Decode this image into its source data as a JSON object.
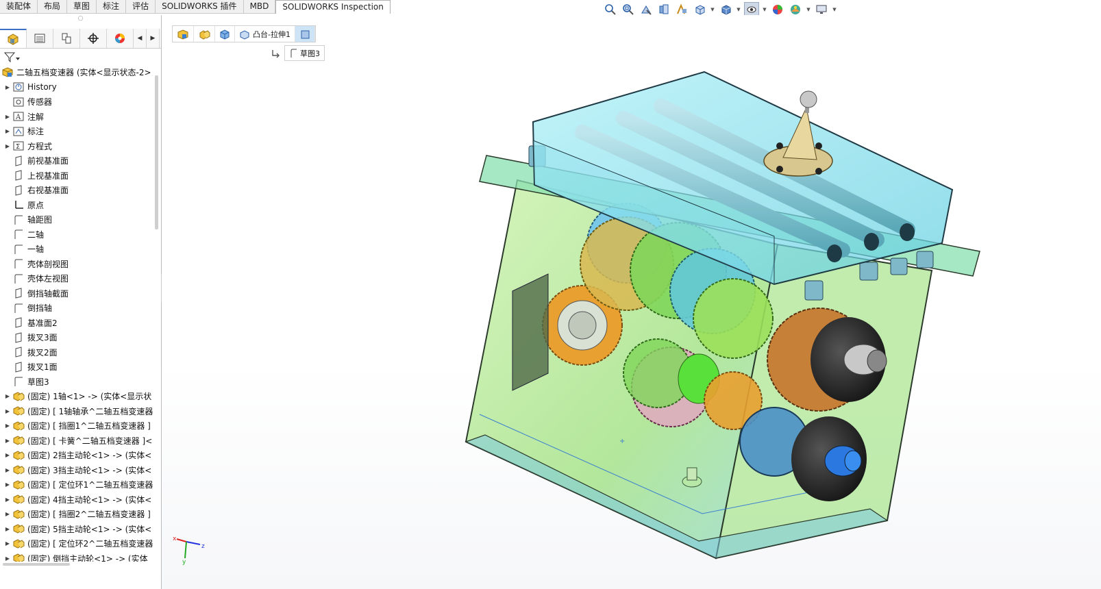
{
  "command_tabs": [
    "装配体",
    "布局",
    "草图",
    "标注",
    "评估",
    "SOLIDWORKS 插件",
    "MBD",
    "SOLIDWORKS Inspection"
  ],
  "active_tab_index": 7,
  "heads_up_toolbar": [
    {
      "icon": "zoom-to-fit-icon"
    },
    {
      "icon": "zoom-area-icon"
    },
    {
      "icon": "previous-view-icon"
    },
    {
      "icon": "section-view-icon"
    },
    {
      "icon": "dynamic-annotation-icon"
    },
    {
      "icon": "view-orientation-icon",
      "dropdown": true
    },
    {
      "icon": "display-style-icon",
      "dropdown": true
    },
    {
      "icon": "hide-show-items-icon",
      "dropdown": true,
      "active": true
    },
    {
      "icon": "edit-appearance-icon"
    },
    {
      "icon": "apply-scene-icon",
      "dropdown": true
    },
    {
      "icon": "view-settings-icon",
      "dropdown": true
    }
  ],
  "panel_tabs": [
    {
      "icon": "featuremanager-tree-icon",
      "active": true
    },
    {
      "icon": "propertymanager-icon"
    },
    {
      "icon": "configurationmanager-icon"
    },
    {
      "icon": "dimxpert-icon"
    },
    {
      "icon": "display-manager-icon"
    }
  ],
  "tree": {
    "root": "二轴五档变速器 (实体<显示状态-2>",
    "items": [
      {
        "label": "History",
        "icon": "history-icon",
        "expand": true
      },
      {
        "label": "传感器",
        "icon": "sensor-icon",
        "expand": false
      },
      {
        "label": "注解",
        "icon": "annotation-icon",
        "expand": true
      },
      {
        "label": "标注",
        "icon": "markup-icon",
        "expand": true
      },
      {
        "label": "方程式",
        "icon": "equation-icon",
        "expand": true
      },
      {
        "label": "前视基准面",
        "icon": "plane-icon",
        "expand": false
      },
      {
        "label": "上视基准面",
        "icon": "plane-icon",
        "expand": false
      },
      {
        "label": "右视基准面",
        "icon": "plane-icon",
        "expand": false
      },
      {
        "label": "原点",
        "icon": "origin-icon",
        "expand": false
      },
      {
        "label": "轴距图",
        "icon": "sketch-icon",
        "expand": false
      },
      {
        "label": "二轴",
        "icon": "sketch-icon",
        "expand": false
      },
      {
        "label": "一轴",
        "icon": "sketch-icon",
        "expand": false
      },
      {
        "label": "壳体剖视图",
        "icon": "sketch-icon",
        "expand": false
      },
      {
        "label": "壳体左视图",
        "icon": "sketch-icon",
        "expand": false
      },
      {
        "label": "倒挡轴截面",
        "icon": "plane-icon",
        "expand": false
      },
      {
        "label": "倒挡轴",
        "icon": "sketch-icon",
        "expand": false
      },
      {
        "label": "基准面2",
        "icon": "plane-icon",
        "expand": false
      },
      {
        "label": "拨叉3面",
        "icon": "plane-icon",
        "expand": false
      },
      {
        "label": "拨叉2面",
        "icon": "plane-icon",
        "expand": false
      },
      {
        "label": "拨叉1面",
        "icon": "plane-icon",
        "expand": false
      },
      {
        "label": "草图3",
        "icon": "sketch-icon",
        "expand": false
      },
      {
        "label": "(固定) 1轴<1> -> (实体<显示状",
        "icon": "part-icon",
        "expand": true
      },
      {
        "label": "(固定) [ 1轴轴承^二轴五档变速器",
        "icon": "part-icon",
        "expand": true
      },
      {
        "label": "(固定) [ 挡圈1^二轴五档变速器 ]",
        "icon": "part-icon",
        "expand": true
      },
      {
        "label": "(固定) [ 卡簧^二轴五档变速器 ]<",
        "icon": "part-icon",
        "expand": true
      },
      {
        "label": "(固定) 2挡主动轮<1> -> (实体<",
        "icon": "part-icon",
        "expand": true
      },
      {
        "label": "(固定) 3挡主动轮<1> -> (实体<",
        "icon": "part-icon",
        "expand": true
      },
      {
        "label": "(固定) [ 定位环1^二轴五档变速器",
        "icon": "part-icon",
        "expand": true
      },
      {
        "label": "(固定) 4挡主动轮<1> -> (实体<",
        "icon": "part-icon",
        "expand": true
      },
      {
        "label": "(固定) [ 挡圈2^二轴五档变速器 ]",
        "icon": "part-icon",
        "expand": true
      },
      {
        "label": "(固定) 5挡主动轮<1> -> (实体<",
        "icon": "part-icon",
        "expand": true
      },
      {
        "label": "(固定) [ 定位环2^二轴五档变速器",
        "icon": "part-icon",
        "expand": true
      },
      {
        "label": "(固定) 倒挡主动轮<1> -> (实体",
        "icon": "part-icon",
        "expand": true
      }
    ]
  },
  "breadcrumb": {
    "feature": "凸台-拉伸1",
    "sketch": "草图3"
  },
  "colors": {
    "accent": "#3a6fc4",
    "housing_green": "#9be07a",
    "cover_cyan": "#6fd8e8",
    "gear_orange": "#e8a030",
    "selected": "#cde4f7"
  }
}
